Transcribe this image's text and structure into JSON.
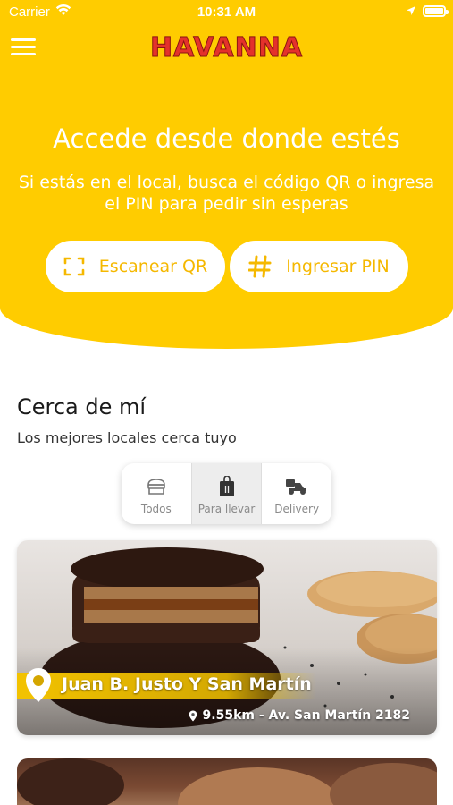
{
  "status_bar": {
    "carrier": "Carrier",
    "time": "10:31 AM"
  },
  "header": {
    "brand": "HAVANNA",
    "brand_color": "#E4322B",
    "background_color": "#FFCC00"
  },
  "hero": {
    "title": "Accede desde donde estés",
    "subtitle_line1": "Si estás en el local, busca el código QR o ingresa",
    "subtitle_line2": "el PIN para pedir sin esperas",
    "scan_qr_label": "Escanear QR",
    "enter_pin_label": "Ingresar PIN"
  },
  "nearby": {
    "title": "Cerca de mí",
    "subtitle": "Los mejores locales cerca tuyo",
    "filters": [
      {
        "label": "Todos",
        "icon": "store-icon",
        "active": false
      },
      {
        "label": "Para llevar",
        "icon": "takeaway-bag-icon",
        "active": true
      },
      {
        "label": "Delivery",
        "icon": "delivery-scooter-icon",
        "active": false
      }
    ],
    "stores": [
      {
        "name": "Juan B. Justo Y San Martín",
        "distance_address": "9.55km - Av. San Martín 2182"
      }
    ]
  }
}
